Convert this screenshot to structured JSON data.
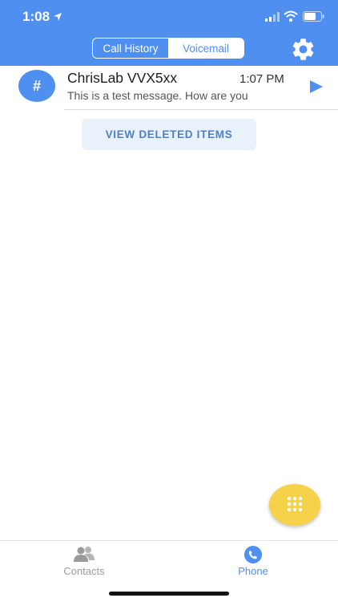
{
  "status_bar": {
    "time": "1:08"
  },
  "header": {
    "tabs": [
      {
        "label": "Call History",
        "selected": false
      },
      {
        "label": "Voicemail",
        "selected": true
      }
    ],
    "settings_icon": "gear-icon"
  },
  "voicemails": [
    {
      "avatar": "#",
      "name": "ChrisLab VVX5xx",
      "time": "1:07 PM",
      "preview": "This is a test message. How are you"
    }
  ],
  "view_deleted_label": "VIEW DELETED ITEMS",
  "fab_icon": "dialpad-icon",
  "tabbar": {
    "tabs": [
      {
        "label": "Contacts",
        "icon": "contacts-icon",
        "active": false
      },
      {
        "label": "Phone",
        "icon": "phone-icon",
        "active": true
      }
    ]
  },
  "colors": {
    "primary": "#4f8ff0",
    "fab": "#f6d24b",
    "button_bg": "#e9f1fb"
  }
}
